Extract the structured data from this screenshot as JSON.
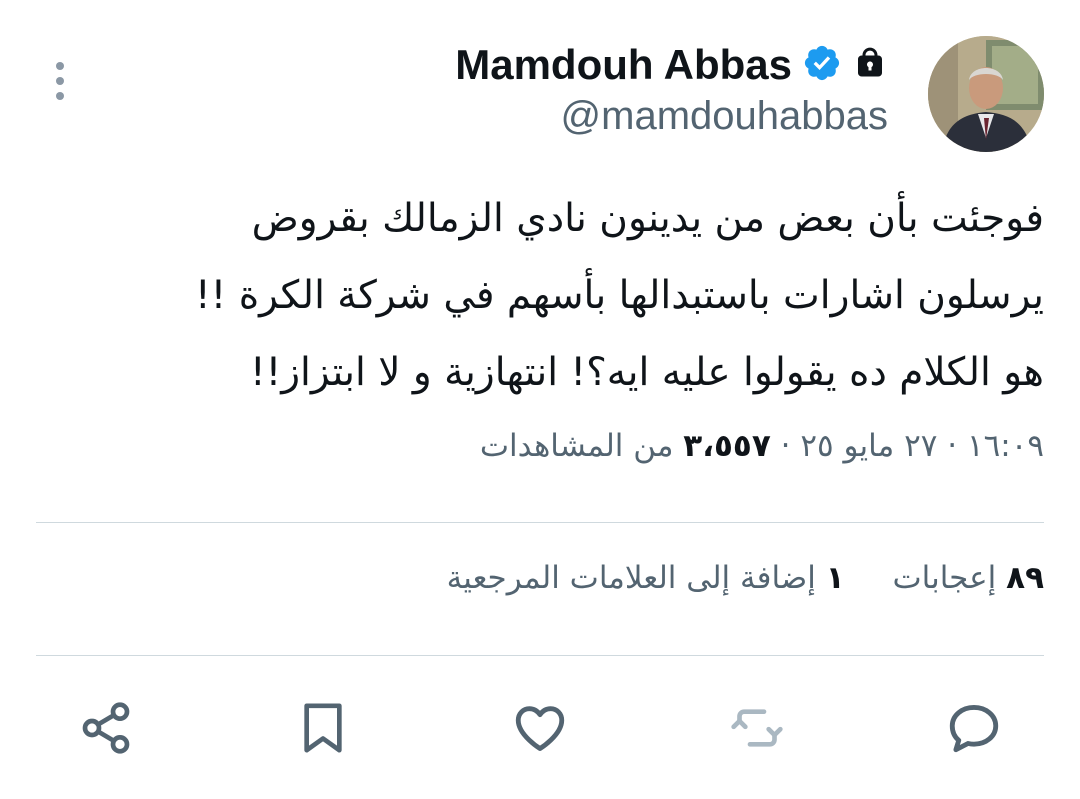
{
  "author": {
    "name": "Mamdouh Abbas",
    "handle": "@mamdouhabbas",
    "verified": true,
    "protected": true
  },
  "tweet": {
    "lines": [
      "فوجئت بأن بعض من يدينون نادي الزمالك بقروض",
      "يرسلون اشارات باستبدالها بأسهم في شركة الكرة !!",
      "هو الكلام ده يقولوا عليه ايه؟! انتهازية و لا ابتزاز!!"
    ]
  },
  "meta": {
    "time": "١٦:٠٩",
    "date": "٢٧ مايو ٢٥",
    "separator": "·",
    "views_count": "٣،٥٥٧",
    "views_label": "من المشاهدات"
  },
  "stats": {
    "likes_count": "٨٩",
    "likes_label": "إعجابات",
    "bookmarks_count": "١",
    "bookmarks_label": "إضافة إلى العلامات المرجعية"
  },
  "colors": {
    "text": "#0f1419",
    "secondary": "#536471",
    "verified": "#1d9bf0",
    "icon": "#536471",
    "icon_disabled": "#aab8c2",
    "divider": "#cfd9de"
  },
  "icons": [
    "more-icon",
    "verified-badge-icon",
    "lock-icon",
    "reply-icon",
    "retweet-icon",
    "like-icon",
    "bookmark-icon",
    "share-icon"
  ]
}
